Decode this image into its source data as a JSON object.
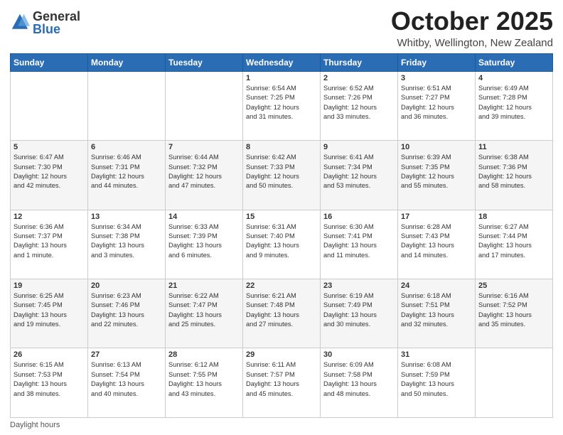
{
  "logo": {
    "general": "General",
    "blue": "Blue"
  },
  "header": {
    "month": "October 2025",
    "location": "Whitby, Wellington, New Zealand"
  },
  "weekdays": [
    "Sunday",
    "Monday",
    "Tuesday",
    "Wednesday",
    "Thursday",
    "Friday",
    "Saturday"
  ],
  "footer": {
    "daylight_label": "Daylight hours"
  },
  "weeks": [
    [
      {
        "day": "",
        "info": ""
      },
      {
        "day": "",
        "info": ""
      },
      {
        "day": "",
        "info": ""
      },
      {
        "day": "1",
        "info": "Sunrise: 6:54 AM\nSunset: 7:25 PM\nDaylight: 12 hours\nand 31 minutes."
      },
      {
        "day": "2",
        "info": "Sunrise: 6:52 AM\nSunset: 7:26 PM\nDaylight: 12 hours\nand 33 minutes."
      },
      {
        "day": "3",
        "info": "Sunrise: 6:51 AM\nSunset: 7:27 PM\nDaylight: 12 hours\nand 36 minutes."
      },
      {
        "day": "4",
        "info": "Sunrise: 6:49 AM\nSunset: 7:28 PM\nDaylight: 12 hours\nand 39 minutes."
      }
    ],
    [
      {
        "day": "5",
        "info": "Sunrise: 6:47 AM\nSunset: 7:30 PM\nDaylight: 12 hours\nand 42 minutes."
      },
      {
        "day": "6",
        "info": "Sunrise: 6:46 AM\nSunset: 7:31 PM\nDaylight: 12 hours\nand 44 minutes."
      },
      {
        "day": "7",
        "info": "Sunrise: 6:44 AM\nSunset: 7:32 PM\nDaylight: 12 hours\nand 47 minutes."
      },
      {
        "day": "8",
        "info": "Sunrise: 6:42 AM\nSunset: 7:33 PM\nDaylight: 12 hours\nand 50 minutes."
      },
      {
        "day": "9",
        "info": "Sunrise: 6:41 AM\nSunset: 7:34 PM\nDaylight: 12 hours\nand 53 minutes."
      },
      {
        "day": "10",
        "info": "Sunrise: 6:39 AM\nSunset: 7:35 PM\nDaylight: 12 hours\nand 55 minutes."
      },
      {
        "day": "11",
        "info": "Sunrise: 6:38 AM\nSunset: 7:36 PM\nDaylight: 12 hours\nand 58 minutes."
      }
    ],
    [
      {
        "day": "12",
        "info": "Sunrise: 6:36 AM\nSunset: 7:37 PM\nDaylight: 13 hours\nand 1 minute."
      },
      {
        "day": "13",
        "info": "Sunrise: 6:34 AM\nSunset: 7:38 PM\nDaylight: 13 hours\nand 3 minutes."
      },
      {
        "day": "14",
        "info": "Sunrise: 6:33 AM\nSunset: 7:39 PM\nDaylight: 13 hours\nand 6 minutes."
      },
      {
        "day": "15",
        "info": "Sunrise: 6:31 AM\nSunset: 7:40 PM\nDaylight: 13 hours\nand 9 minutes."
      },
      {
        "day": "16",
        "info": "Sunrise: 6:30 AM\nSunset: 7:41 PM\nDaylight: 13 hours\nand 11 minutes."
      },
      {
        "day": "17",
        "info": "Sunrise: 6:28 AM\nSunset: 7:43 PM\nDaylight: 13 hours\nand 14 minutes."
      },
      {
        "day": "18",
        "info": "Sunrise: 6:27 AM\nSunset: 7:44 PM\nDaylight: 13 hours\nand 17 minutes."
      }
    ],
    [
      {
        "day": "19",
        "info": "Sunrise: 6:25 AM\nSunset: 7:45 PM\nDaylight: 13 hours\nand 19 minutes."
      },
      {
        "day": "20",
        "info": "Sunrise: 6:23 AM\nSunset: 7:46 PM\nDaylight: 13 hours\nand 22 minutes."
      },
      {
        "day": "21",
        "info": "Sunrise: 6:22 AM\nSunset: 7:47 PM\nDaylight: 13 hours\nand 25 minutes."
      },
      {
        "day": "22",
        "info": "Sunrise: 6:21 AM\nSunset: 7:48 PM\nDaylight: 13 hours\nand 27 minutes."
      },
      {
        "day": "23",
        "info": "Sunrise: 6:19 AM\nSunset: 7:49 PM\nDaylight: 13 hours\nand 30 minutes."
      },
      {
        "day": "24",
        "info": "Sunrise: 6:18 AM\nSunset: 7:51 PM\nDaylight: 13 hours\nand 32 minutes."
      },
      {
        "day": "25",
        "info": "Sunrise: 6:16 AM\nSunset: 7:52 PM\nDaylight: 13 hours\nand 35 minutes."
      }
    ],
    [
      {
        "day": "26",
        "info": "Sunrise: 6:15 AM\nSunset: 7:53 PM\nDaylight: 13 hours\nand 38 minutes."
      },
      {
        "day": "27",
        "info": "Sunrise: 6:13 AM\nSunset: 7:54 PM\nDaylight: 13 hours\nand 40 minutes."
      },
      {
        "day": "28",
        "info": "Sunrise: 6:12 AM\nSunset: 7:55 PM\nDaylight: 13 hours\nand 43 minutes."
      },
      {
        "day": "29",
        "info": "Sunrise: 6:11 AM\nSunset: 7:57 PM\nDaylight: 13 hours\nand 45 minutes."
      },
      {
        "day": "30",
        "info": "Sunrise: 6:09 AM\nSunset: 7:58 PM\nDaylight: 13 hours\nand 48 minutes."
      },
      {
        "day": "31",
        "info": "Sunrise: 6:08 AM\nSunset: 7:59 PM\nDaylight: 13 hours\nand 50 minutes."
      },
      {
        "day": "",
        "info": ""
      }
    ]
  ]
}
